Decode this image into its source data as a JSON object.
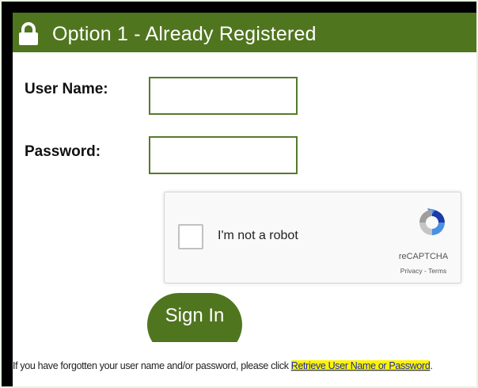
{
  "header": {
    "title": "Option 1 - Already Registered",
    "icon": "lock-icon",
    "background_color": "#50751f"
  },
  "form": {
    "username_label": "User Name:",
    "username_value": "",
    "password_label": "Password:",
    "password_value": "",
    "field_border_color": "#557a2a"
  },
  "captcha": {
    "label": "I'm not a robot",
    "checked": false,
    "brand": "reCAPTCHA",
    "links": "Privacy - Terms"
  },
  "signin": {
    "label": "Sign In"
  },
  "footer": {
    "text": "If you have forgotten your user name and/or password, please click ",
    "link_label": "Retrieve User Name or Password",
    "trailing": ".",
    "link_highlight_color": "#fff200"
  }
}
